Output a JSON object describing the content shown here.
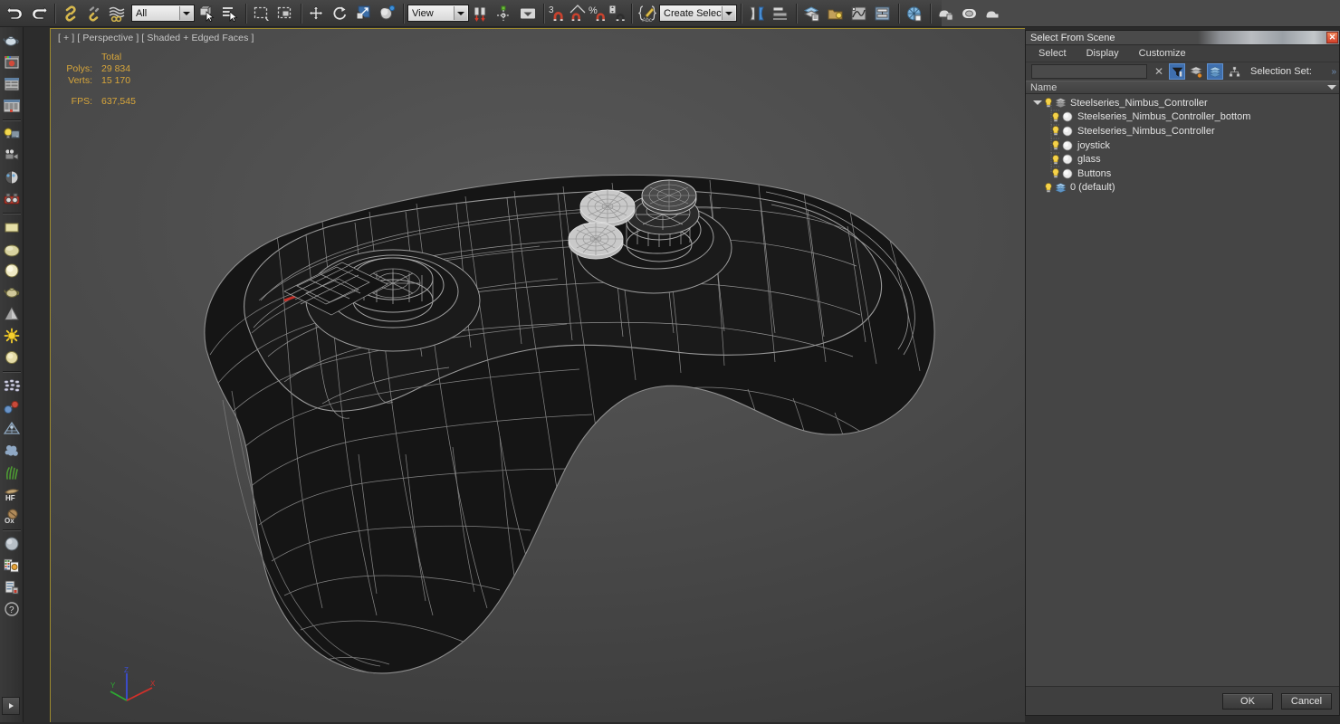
{
  "app": {
    "bg_color": "#2b2b2b",
    "accent_gold": "#d8a63a",
    "viewport_border": "#9d8a2e",
    "select_highlight": "#3f6fae"
  },
  "toolbar": {
    "items": [
      {
        "name": "undo-icon",
        "label": "Undo"
      },
      {
        "name": "redo-icon",
        "label": "Redo"
      },
      {
        "name": "select-and-link-icon",
        "label": "Select and Link"
      },
      {
        "name": "unlink-selection-icon",
        "label": "Unlink Selection"
      },
      {
        "name": "bind-to-space-warp-icon",
        "label": "Bind to Space Warp"
      },
      {
        "name": "selection-filter-combo",
        "label": "All"
      },
      {
        "name": "select-object-icon",
        "label": "Select Object"
      },
      {
        "name": "select-by-name-icon",
        "label": "Select by Name"
      },
      {
        "name": "rectangular-selection-region-icon",
        "label": "Rectangular Selection Region"
      },
      {
        "name": "window-crossing-icon",
        "label": "Window / Crossing"
      },
      {
        "name": "select-and-move-icon",
        "label": "Select and Move"
      },
      {
        "name": "select-and-rotate-icon",
        "label": "Select and Rotate"
      },
      {
        "name": "select-and-scale-icon",
        "label": "Select and Uniform Scale"
      },
      {
        "name": "select-and-place-icon",
        "label": "Select and Place"
      },
      {
        "name": "reference-coordinate-system-combo",
        "label": "View"
      },
      {
        "name": "use-pivot-point-center-icon",
        "label": "Use Pivot Point Center"
      },
      {
        "name": "select-and-manipulate-icon",
        "label": "Select and Manipulate"
      },
      {
        "name": "snaps-toggle-icon",
        "label": "3D Snaps Toggle"
      },
      {
        "name": "angle-snap-toggle-icon",
        "label": "Angle Snap Toggle"
      },
      {
        "name": "percent-snap-toggle-icon",
        "label": "Percent Snap Toggle"
      },
      {
        "name": "spinner-snap-toggle-icon",
        "label": "Spinner Snap Toggle"
      },
      {
        "name": "edit-named-selection-sets-icon",
        "label": "Edit Named Selection Sets"
      },
      {
        "name": "named-selection-set-combo",
        "label": "Create Selection Se"
      },
      {
        "name": "mirror-icon",
        "label": "Mirror"
      },
      {
        "name": "align-icon",
        "label": "Align"
      },
      {
        "name": "layer-explorer-icon",
        "label": "Toggle Layer Explorer"
      },
      {
        "name": "scene-explorer-icon",
        "label": "Toggle Scene Explorer"
      },
      {
        "name": "curve-editor-icon",
        "label": "Curve Editor"
      },
      {
        "name": "schematic-view-icon",
        "label": "Schematic View"
      },
      {
        "name": "material-editor-icon",
        "label": "Material Editor"
      },
      {
        "name": "render-setup-icon",
        "label": "Render Setup"
      },
      {
        "name": "rendered-frame-window-icon",
        "label": "Rendered Frame Window"
      },
      {
        "name": "render-production-icon",
        "label": "Render Production"
      }
    ],
    "combo_all": "All",
    "combo_view": "View",
    "combo_selection_set": "Create Selection Se",
    "snap_number": "3",
    "percent_glyph": "%"
  },
  "leftbar": {
    "items": [
      {
        "name": "teapot-object-icon",
        "label": "Standard Primitives"
      },
      {
        "name": "material-preview-icon",
        "label": "Material Preview"
      },
      {
        "name": "command-panel-icon",
        "label": "Command Panel"
      },
      {
        "name": "modify-panel-icon",
        "label": "Modify Panel"
      },
      {
        "name": "light-icon",
        "label": "Lights"
      },
      {
        "name": "camera-icon",
        "label": "Cameras"
      },
      {
        "name": "target-camera-icon",
        "label": "Target Camera"
      },
      {
        "name": "physical-camera-icon",
        "label": "Physical Camera"
      },
      {
        "name": "plane-primitive-icon",
        "label": "Plane"
      },
      {
        "name": "sphere-primitive-icon",
        "label": "Sphere"
      },
      {
        "name": "sphere-light-icon",
        "label": "Sphere Light"
      },
      {
        "name": "teapot-primitive-icon",
        "label": "Teapot"
      },
      {
        "name": "cone-primitive-icon",
        "label": "Cone"
      },
      {
        "name": "sun-light-icon",
        "label": "Sun Light"
      },
      {
        "name": "dome-light-icon",
        "label": "Dome Light"
      },
      {
        "name": "particles-icon",
        "label": "Particle Systems"
      },
      {
        "name": "molecule-icon",
        "label": "Compound Objects"
      },
      {
        "name": "space-warp-icon",
        "label": "Space Warps"
      },
      {
        "name": "noise-icon",
        "label": "Noise"
      },
      {
        "name": "hair-and-fur-icon",
        "label": "Hair and Fur"
      },
      {
        "name": "hf-icon",
        "label": "HF"
      },
      {
        "name": "ox-icon",
        "label": "Ox"
      },
      {
        "name": "sphere-shaded-icon",
        "label": "Shaded Sphere"
      },
      {
        "name": "render-settings-icon",
        "label": "Render Settings"
      },
      {
        "name": "batch-render-icon",
        "label": "Batch Render"
      },
      {
        "name": "help-icon",
        "label": "Help"
      }
    ],
    "play_button": "play-icon"
  },
  "viewport": {
    "label": "[ + ] [ Perspective ] [ Shaded + Edged Faces ]",
    "stats": {
      "header": "Total",
      "rows": [
        {
          "key": "Polys:",
          "value": "29 834"
        },
        {
          "key": "Verts:",
          "value": "15 170"
        }
      ],
      "fps_key": "FPS:",
      "fps_value": "637,545"
    },
    "axis": {
      "x": "X",
      "y": "Y",
      "z": "Z"
    },
    "model": "Steelseries Nimbus Controller wireframe"
  },
  "dialog": {
    "title": "Select From Scene",
    "close_icon": "close-icon",
    "menu": [
      "Select",
      "Display",
      "Customize"
    ],
    "filter": {
      "search_value": "",
      "search_placeholder": "",
      "clear_icon": "clear-icon",
      "buttons": [
        {
          "name": "display-filter-icon",
          "active": true
        },
        {
          "name": "sort-by-layer-icon",
          "active": false
        },
        {
          "name": "layer-list-icon",
          "active": true
        },
        {
          "name": "hierarchy-icon",
          "active": false
        }
      ],
      "selection_set_label": "Selection Set:"
    },
    "column_header": "Name",
    "tree": [
      {
        "label": "Steelseries_Nimbus_Controller",
        "depth": 0,
        "type": "layer",
        "expanded": true
      },
      {
        "label": "Steelseries_Nimbus_Controller_bottom",
        "depth": 1,
        "type": "object"
      },
      {
        "label": "Steelseries_Nimbus_Controller",
        "depth": 1,
        "type": "object"
      },
      {
        "label": "joystick",
        "depth": 1,
        "type": "object"
      },
      {
        "label": "glass",
        "depth": 1,
        "type": "object"
      },
      {
        "label": "Buttons",
        "depth": 1,
        "type": "object"
      },
      {
        "label": "0 (default)",
        "depth": 0,
        "type": "layer",
        "expanded": false
      }
    ],
    "buttons": {
      "ok": "OK",
      "cancel": "Cancel"
    }
  }
}
